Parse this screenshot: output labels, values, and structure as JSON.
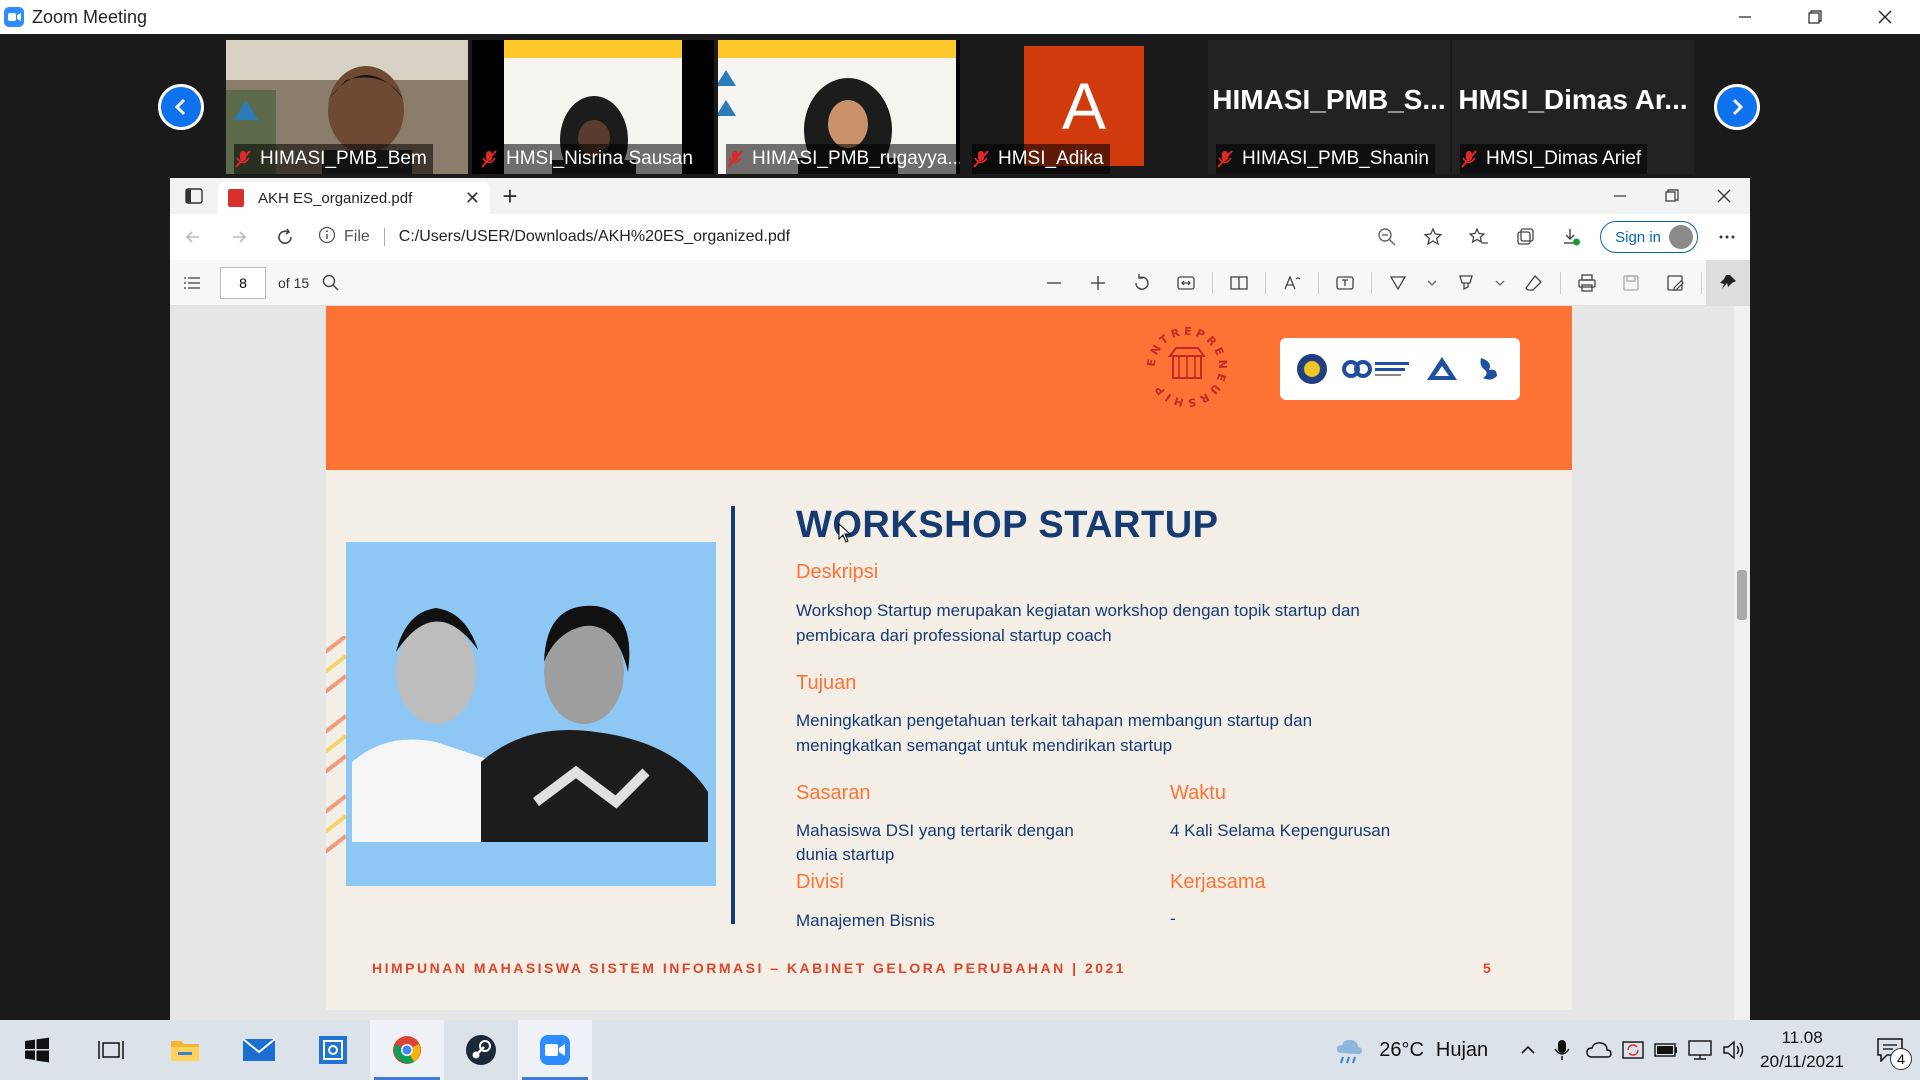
{
  "zoom": {
    "title": "Zoom Meeting",
    "participants": [
      {
        "name": "HIMASI_PMB_Bem",
        "type": "video"
      },
      {
        "name": "HMSI_Nisrina Sausan",
        "type": "video"
      },
      {
        "name": "HIMASI_PMB_rugayya...",
        "type": "video"
      },
      {
        "name": "HMSI_Adika",
        "type": "avatar",
        "initial": "A",
        "color": "#d13a0d"
      },
      {
        "name": "HIMASI_PMB_Shanin",
        "type": "text",
        "display": "HIMASI_PMB_S..."
      },
      {
        "name": "HMSI_Dimas Arief",
        "type": "text",
        "display": "HMSI_Dimas  Ar..."
      }
    ]
  },
  "browser": {
    "tab_title": "AKH ES_organized.pdf",
    "file_label": "File",
    "url": "C:/Users/USER/Downloads/AKH%20ES_organized.pdf",
    "signin_label": "Sign in",
    "page_number": "8",
    "page_total": "of 15"
  },
  "pdf": {
    "title": "WORKSHOP STARTUP",
    "ent_logo_text": "ENTREPRENEURSHIP",
    "deskripsi_label": "Deskripsi",
    "deskripsi_line1": "Workshop Startup merupakan kegiatan workshop dengan topik startup dan",
    "deskripsi_line2": "pembicara dari professional  startup coach",
    "tujuan_label": "Tujuan",
    "tujuan_line1": "Meningkatkan pengetahuan terkait tahapan membangun startup dan",
    "tujuan_line2": "meningkatkan semangat untuk mendirikan startup",
    "sasaran_label": "Sasaran",
    "sasaran_line1": "Mahasiswa DSI yang tertarik dengan",
    "sasaran_line2": "dunia startup",
    "waktu_label": "Waktu",
    "waktu_value": "4 Kali Selama Kepengurusan",
    "divisi_label": "Divisi",
    "divisi_value": "Manajemen Bisnis",
    "kerjasama_label": "Kerjasama",
    "kerjasama_value": "-",
    "footer": "HIMPUNAN MAHASISWA SISTEM INFORMASI – KABINET GELORA PERUBAHAN | 2021",
    "page_no": "5",
    "accent": "#ff7236",
    "navy": "#163a72"
  },
  "taskbar": {
    "weather_temp": "26°C",
    "weather_text": "Hujan",
    "time": "11.08",
    "date": "20/11/2021",
    "notification_count": "4"
  }
}
